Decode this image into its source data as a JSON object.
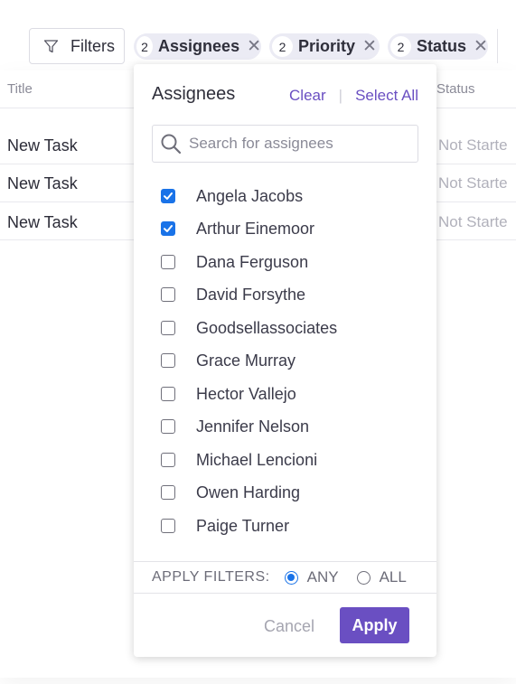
{
  "table": {
    "columns": {
      "title": "Title",
      "status": "Status"
    },
    "rows": [
      {
        "title": "New Task",
        "status": "Not Starte"
      },
      {
        "title": "New Task",
        "status": "Not Starte"
      },
      {
        "title": "New Task",
        "status": "Not Starte"
      }
    ]
  },
  "filter_bar": {
    "filters_label": "Filters",
    "chips": [
      {
        "count": "2",
        "label": "Assignees"
      },
      {
        "count": "2",
        "label": "Priority"
      },
      {
        "count": "2",
        "label": "Status"
      }
    ]
  },
  "panel": {
    "title": "Assignees",
    "clear_label": "Clear",
    "separator": "|",
    "select_all_label": "Select All",
    "search_placeholder": "Search for assignees",
    "options": [
      {
        "label": "Angela Jacobs",
        "checked": true
      },
      {
        "label": "Arthur Einemoor",
        "checked": true
      },
      {
        "label": "Dana Ferguson",
        "checked": false
      },
      {
        "label": "David Forsythe",
        "checked": false
      },
      {
        "label": "Goodsellassociates",
        "checked": false
      },
      {
        "label": "Grace Murray",
        "checked": false
      },
      {
        "label": "Hector Vallejo",
        "checked": false
      },
      {
        "label": "Jennifer Nelson",
        "checked": false
      },
      {
        "label": "Michael Lencioni",
        "checked": false
      },
      {
        "label": "Owen Harding",
        "checked": false
      },
      {
        "label": "Paige Turner",
        "checked": false
      }
    ],
    "apply_filters_label": "APPLY FILTERS:",
    "match_options": [
      {
        "label": "ANY",
        "selected": true
      },
      {
        "label": "ALL",
        "selected": false
      }
    ],
    "cancel_label": "Cancel",
    "apply_label": "Apply"
  },
  "colors": {
    "accent": "#6a4fc2",
    "checkbox": "#1a73e8",
    "chip_bg": "#ebebf4"
  }
}
